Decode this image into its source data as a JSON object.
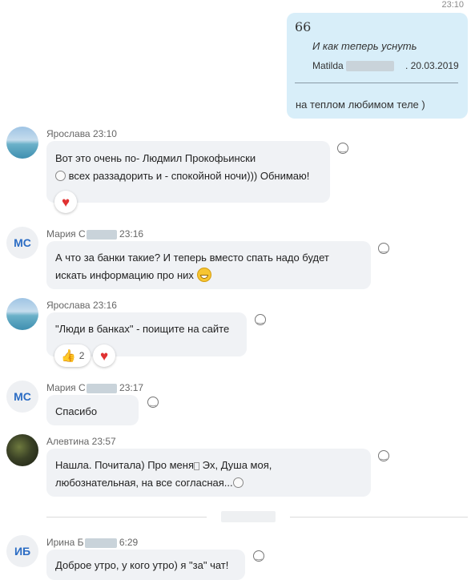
{
  "own_message": {
    "time": "23:10",
    "quote_mark": "66",
    "quote_text": "И как теперь уснуть",
    "quote_author": "Matilda",
    "quote_date": ". 20.03.2019",
    "text": "на теплом любимом теле )"
  },
  "messages": [
    {
      "sender": "Ярослава",
      "time": "23:10",
      "line1": "Вот это очень по- Людмил Прокофьински",
      "line2": "всех раззадорить и - спокойной ночи))) Обнимаю!",
      "reactions": [
        {
          "icon": "heart"
        }
      ]
    },
    {
      "avatar_initials": "МС",
      "sender": "Мария С",
      "time": "23:16",
      "line1": "А что за банки такие? И теперь вместо спать надо будет",
      "line2": "искать информацию про них"
    },
    {
      "sender": "Ярослава",
      "time": "23:16",
      "line1": "\"Люди в банках\" - поищите на сайте",
      "reactions": [
        {
          "icon": "thumbs-up",
          "count": "2"
        },
        {
          "icon": "heart"
        }
      ]
    },
    {
      "avatar_initials": "МС",
      "sender": "Мария С",
      "time": "23:17",
      "line1": "Спасибо"
    },
    {
      "sender": "Алевтина",
      "time": "23:57",
      "line1": "Нашла. Почитала) Про меня",
      "line1b": " Эх, Душа моя,",
      "line2": "любознательная, на все согласная..."
    },
    {
      "avatar_initials": "ИБ",
      "sender": "Ирина Б",
      "time": "6:29",
      "line1": "Доброе утро, у кого утро) я \"за\" чат!"
    }
  ],
  "colors": {
    "own_bubble": "#d8eef9",
    "other_bubble": "#f0f2f5",
    "initials": "#2b6cc4",
    "heart": "#e03131"
  }
}
